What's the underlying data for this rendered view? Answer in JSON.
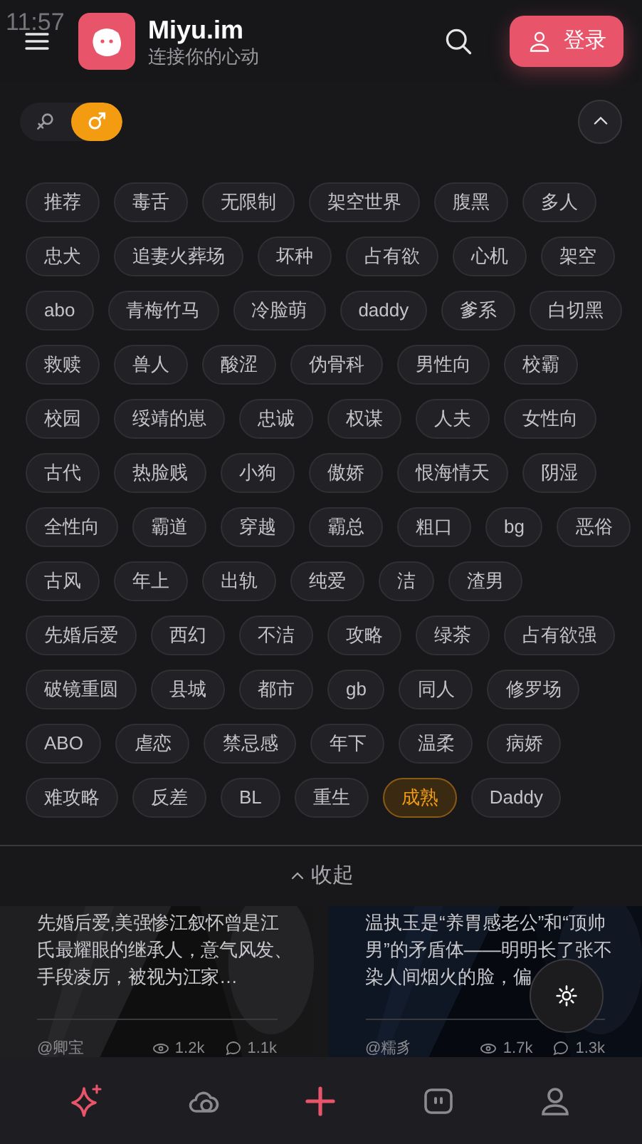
{
  "status_bar": {
    "time": "11:57"
  },
  "header": {
    "title": "Miyu.im",
    "subtitle": "连接你的心动",
    "login_button": "登录"
  },
  "gender_filter": [
    {
      "kind": "female",
      "selected": false
    },
    {
      "kind": "male",
      "selected": true
    }
  ],
  "tag_rows": [
    [
      {
        "label": "推荐",
        "selected": false
      },
      {
        "label": "毒舌",
        "selected": false
      },
      {
        "label": "无限制",
        "selected": false
      },
      {
        "label": "架空世界",
        "selected": false
      },
      {
        "label": "腹黑",
        "selected": false
      },
      {
        "label": "多人",
        "selected": false
      }
    ],
    [
      {
        "label": "忠犬",
        "selected": false
      },
      {
        "label": "追妻火葬场",
        "selected": false
      },
      {
        "label": "坏种",
        "selected": false
      },
      {
        "label": "占有欲",
        "selected": false
      },
      {
        "label": "心机",
        "selected": false
      },
      {
        "label": "架空",
        "selected": false
      }
    ],
    [
      {
        "label": "abo",
        "selected": false
      },
      {
        "label": "青梅竹马",
        "selected": false
      },
      {
        "label": "冷脸萌",
        "selected": false
      },
      {
        "label": "daddy",
        "selected": false
      },
      {
        "label": "爹系",
        "selected": false
      },
      {
        "label": "白切黑",
        "selected": false
      }
    ],
    [
      {
        "label": "救赎",
        "selected": false
      },
      {
        "label": "兽人",
        "selected": false
      },
      {
        "label": "酸涩",
        "selected": false
      },
      {
        "label": "伪骨科",
        "selected": false
      },
      {
        "label": "男性向",
        "selected": false
      },
      {
        "label": "校霸",
        "selected": false
      }
    ],
    [
      {
        "label": "校园",
        "selected": false
      },
      {
        "label": "绥靖的崽",
        "selected": false
      },
      {
        "label": "忠诚",
        "selected": false
      },
      {
        "label": "权谋",
        "selected": false
      },
      {
        "label": "人夫",
        "selected": false
      },
      {
        "label": "女性向",
        "selected": false
      }
    ],
    [
      {
        "label": "古代",
        "selected": false
      },
      {
        "label": "热脸贱",
        "selected": false
      },
      {
        "label": "小狗",
        "selected": false
      },
      {
        "label": "傲娇",
        "selected": false
      },
      {
        "label": "恨海情天",
        "selected": false
      },
      {
        "label": "阴湿",
        "selected": false
      }
    ],
    [
      {
        "label": "全性向",
        "selected": false
      },
      {
        "label": "霸道",
        "selected": false
      },
      {
        "label": "穿越",
        "selected": false
      },
      {
        "label": "霸总",
        "selected": false
      },
      {
        "label": "粗口",
        "selected": false
      },
      {
        "label": "bg",
        "selected": false
      },
      {
        "label": "恶俗",
        "selected": false
      }
    ],
    [
      {
        "label": "古风",
        "selected": false
      },
      {
        "label": "年上",
        "selected": false
      },
      {
        "label": "出轨",
        "selected": false
      },
      {
        "label": "纯爱",
        "selected": false
      },
      {
        "label": "洁",
        "selected": false
      },
      {
        "label": "渣男",
        "selected": false
      }
    ],
    [
      {
        "label": "先婚后爱",
        "selected": false
      },
      {
        "label": "西幻",
        "selected": false
      },
      {
        "label": "不洁",
        "selected": false
      },
      {
        "label": "攻略",
        "selected": false
      },
      {
        "label": "绿茶",
        "selected": false
      },
      {
        "label": "占有欲强",
        "selected": false
      }
    ],
    [
      {
        "label": "破镜重圆",
        "selected": false
      },
      {
        "label": "县城",
        "selected": false
      },
      {
        "label": "都市",
        "selected": false
      },
      {
        "label": "gb",
        "selected": false
      },
      {
        "label": "同人",
        "selected": false
      },
      {
        "label": "修罗场",
        "selected": false
      }
    ],
    [
      {
        "label": "ABO",
        "selected": false
      },
      {
        "label": "虐恋",
        "selected": false
      },
      {
        "label": "禁忌感",
        "selected": false
      },
      {
        "label": "年下",
        "selected": false
      },
      {
        "label": "温柔",
        "selected": false
      },
      {
        "label": "病娇",
        "selected": false
      }
    ],
    [
      {
        "label": "难攻略",
        "selected": false
      },
      {
        "label": "反差",
        "selected": false
      },
      {
        "label": "BL",
        "selected": false
      },
      {
        "label": "重生",
        "selected": false
      },
      {
        "label": "成熟",
        "selected": true
      },
      {
        "label": "Daddy",
        "selected": false
      }
    ]
  ],
  "collapse_button": "收起",
  "cards": [
    {
      "kind": "picture",
      "description": "先婚后爱,美强惨江叙怀曾是江氏最耀眼的继承人，意气风发、手段凌厉，被视为江家…",
      "author": "@卿宝",
      "views": "1.2k",
      "comments": "1.1k"
    },
    {
      "kind": "picture",
      "description": "温执玉是“养胃感老公”和“顶帅男”的矛盾体——明明长了张不染人间烟火的脸，偏",
      "author": "@糯豸",
      "views": "1.7k",
      "comments": "1.3k"
    }
  ],
  "bottom_nav": [
    {
      "kind": "discover",
      "selected": true
    },
    {
      "kind": "community",
      "selected": false
    },
    {
      "kind": "create"
    },
    {
      "kind": "messages",
      "selected": false
    },
    {
      "kind": "profile",
      "selected": false
    }
  ]
}
